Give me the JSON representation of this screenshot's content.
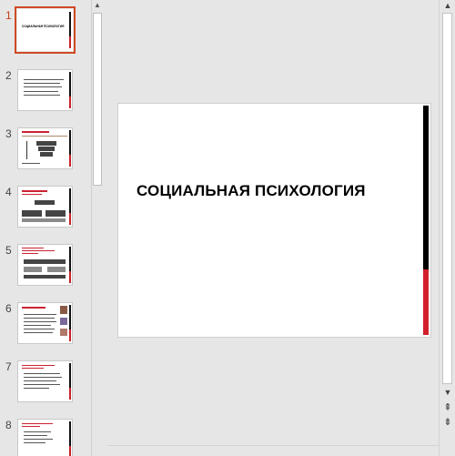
{
  "slides": [
    {
      "num": "1",
      "active": true,
      "title": "СОЦИАЛЬНАЯ ПСИХОЛОГИЯ"
    },
    {
      "num": "2",
      "active": false
    },
    {
      "num": "3",
      "active": false
    },
    {
      "num": "4",
      "active": false
    },
    {
      "num": "5",
      "active": false
    },
    {
      "num": "6",
      "active": false
    },
    {
      "num": "7",
      "active": false
    },
    {
      "num": "8",
      "active": false
    }
  ],
  "main_slide": {
    "title": "СОЦИАЛЬНАЯ ПСИХОЛОГИЯ"
  },
  "icons": {
    "scroll_up": "up-arrow-icon",
    "scroll_down": "down-arrow-icon",
    "prev_slide": "double-up-arrow-icon",
    "next_slide": "double-down-arrow-icon"
  },
  "colors": {
    "accent_red": "#d21f2b",
    "selection": "#d04a25"
  }
}
